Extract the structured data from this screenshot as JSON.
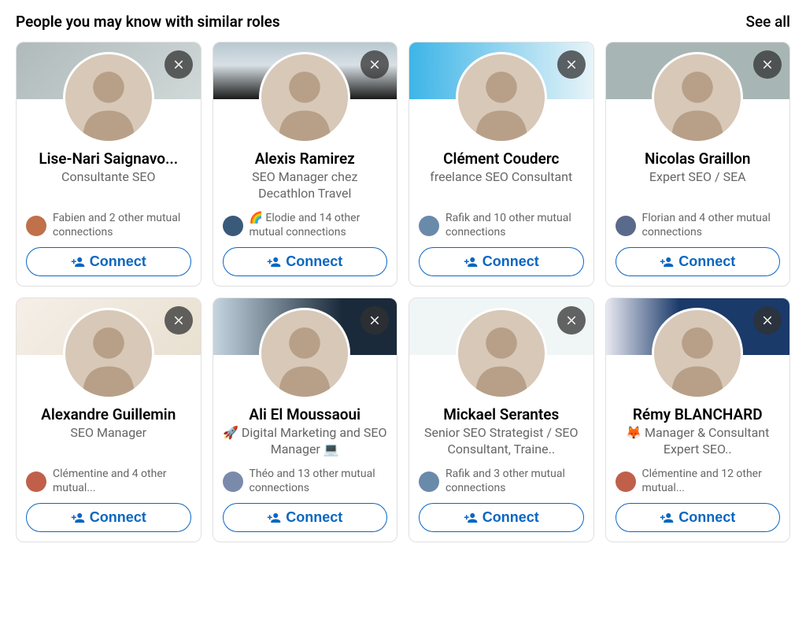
{
  "header": {
    "title": "People you may know with similar roles",
    "see_all": "See all"
  },
  "connect_label": "Connect",
  "people": [
    {
      "name": "Lise-Nari Saignavo...",
      "title": "Consultante SEO",
      "mutual": "Fabien and 2 other mutual connections",
      "banner_class": "b1"
    },
    {
      "name": "Alexis Ramirez",
      "title": "SEO Manager chez Decathlon Travel",
      "mutual": "🌈 Elodie and 14 other mutual connections",
      "banner_class": "b2"
    },
    {
      "name": "Clément Couderc",
      "title": "freelance SEO Consultant",
      "mutual": "Rafik and 10 other mutual connections",
      "banner_class": "b3"
    },
    {
      "name": "Nicolas Graillon",
      "title": "Expert SEO / SEA",
      "mutual": "Florian and 4 other mutual connections",
      "banner_class": "b4"
    },
    {
      "name": "Alexandre Guillemin",
      "title": "SEO Manager",
      "mutual": "Clémentine and 4 other mutual...",
      "banner_class": "b5"
    },
    {
      "name": "Ali El Moussaoui",
      "title": "🚀 Digital Marketing and SEO Manager 💻",
      "mutual": "Théo and 13 other mutual connections",
      "banner_class": "b6"
    },
    {
      "name": "Mickael Serantes",
      "title": "Senior SEO Strategist / SEO Consultant, Traine..",
      "mutual": "Rafik and 3 other mutual connections",
      "banner_class": "b7"
    },
    {
      "name": "Rémy BLANCHARD",
      "title": "🦊 Manager & Consultant Expert SEO..",
      "mutual": "Clémentine and 12 other mutual...",
      "banner_class": "b8"
    }
  ]
}
